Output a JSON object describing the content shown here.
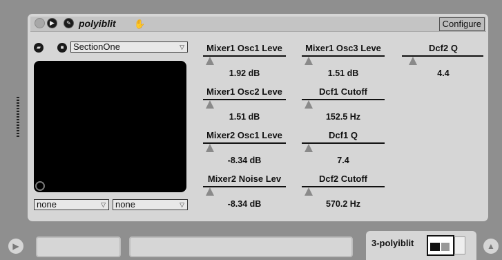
{
  "device": {
    "name": "polyiblit",
    "configure_label": "Configure"
  },
  "xy_control": {
    "preset_value": "SectionOne",
    "x_assign_value": "none",
    "y_assign_value": "none"
  },
  "params": [
    {
      "name": "Mixer1 Osc1 Leve",
      "value": "1.92 dB"
    },
    {
      "name": "Mixer1 Osc2 Leve",
      "value": "1.51 dB"
    },
    {
      "name": "Mixer2 Osc1 Leve",
      "value": "-8.34 dB"
    },
    {
      "name": "Mixer2 Noise Lev",
      "value": "-8.34 dB"
    },
    {
      "name": "Mixer1 Osc3 Leve",
      "value": "1.51 dB"
    },
    {
      "name": "Dcf1 Cutoff",
      "value": "152.5 Hz"
    },
    {
      "name": "Dcf1 Q",
      "value": "7.4"
    },
    {
      "name": "Dcf2 Cutoff",
      "value": "570.2 Hz"
    },
    {
      "name": "Dcf2 Q",
      "value": "4.4"
    }
  ],
  "bottom": {
    "track_tab_label": "3-polyiblit"
  },
  "icons": {
    "power": "power-icon",
    "play": "play-icon",
    "wrench": "wrench-icon",
    "hand": "hand-icon",
    "folder": "folder-icon",
    "save": "save-icon",
    "chevron": "chevron-down-icon"
  },
  "colors": {
    "panel": "#d6d6d6",
    "background": "#8f8f8f",
    "xy_pad": "#000000"
  }
}
